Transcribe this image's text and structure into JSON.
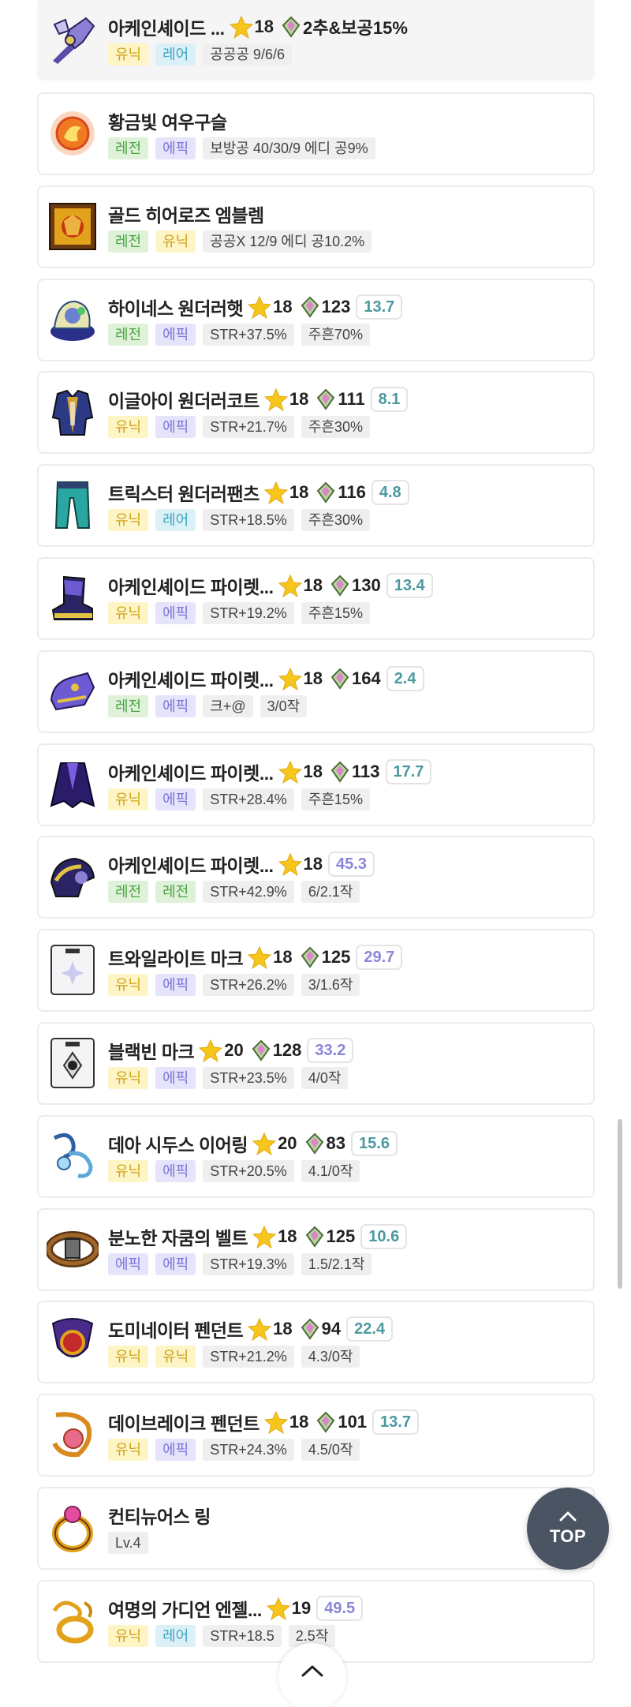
{
  "items": [
    {
      "name": "아케인셰이드 ...",
      "icon": "arcane-shade-weapon-icon",
      "star": "18",
      "gem": "",
      "extra": "2추&보공15%",
      "score": "",
      "score_color": "",
      "tags": [
        "유닉",
        "레어"
      ],
      "tag_types": [
        "unique",
        "rare"
      ],
      "opts": [
        "공공공 9/6/6"
      ]
    },
    {
      "name": "황금빛 여우구슬",
      "icon": "golden-fox-marble-icon",
      "star": "",
      "gem": "",
      "extra": "",
      "score": "",
      "score_color": "",
      "tags": [
        "레전",
        "에픽"
      ],
      "tag_types": [
        "legend",
        "epic"
      ],
      "opts": [
        "보방공 40/30/9 에디 공9%"
      ]
    },
    {
      "name": "골드 히어로즈 엠블렘",
      "icon": "gold-heroes-emblem-icon",
      "star": "",
      "gem": "",
      "extra": "",
      "score": "",
      "score_color": "",
      "tags": [
        "레전",
        "유닉"
      ],
      "tag_types": [
        "legend",
        "unique"
      ],
      "opts": [
        "공공X 12/9 에디 공10.2%"
      ]
    },
    {
      "name": "하이네스 원더러햇",
      "icon": "highness-wanderer-hat-icon",
      "star": "18",
      "gem": "123",
      "extra": "",
      "score": "13.7",
      "score_color": "teal",
      "tags": [
        "레전",
        "에픽"
      ],
      "tag_types": [
        "legend",
        "epic"
      ],
      "opts": [
        "STR+37.5%",
        "주흔70%"
      ]
    },
    {
      "name": "이글아이 원더러코트",
      "icon": "eagle-eye-wanderer-coat-icon",
      "star": "18",
      "gem": "111",
      "extra": "",
      "score": "8.1",
      "score_color": "teal",
      "tags": [
        "유닉",
        "에픽"
      ],
      "tag_types": [
        "unique",
        "epic"
      ],
      "opts": [
        "STR+21.7%",
        "주흔30%"
      ]
    },
    {
      "name": "트릭스터 원더러팬츠",
      "icon": "trickster-wanderer-pants-icon",
      "star": "18",
      "gem": "116",
      "extra": "",
      "score": "4.8",
      "score_color": "teal",
      "tags": [
        "유닉",
        "레어"
      ],
      "tag_types": [
        "unique",
        "rare"
      ],
      "opts": [
        "STR+18.5%",
        "주흔30%"
      ]
    },
    {
      "name": "아케인셰이드 파이렛...",
      "icon": "arcane-shade-pirate-shoes-icon",
      "star": "18",
      "gem": "130",
      "extra": "",
      "score": "13.4",
      "score_color": "teal",
      "tags": [
        "유닉",
        "에픽"
      ],
      "tag_types": [
        "unique",
        "epic"
      ],
      "opts": [
        "STR+19.2%",
        "주흔15%"
      ]
    },
    {
      "name": "아케인셰이드 파이렛...",
      "icon": "arcane-shade-pirate-gloves-icon",
      "star": "18",
      "gem": "164",
      "extra": "",
      "score": "2.4",
      "score_color": "teal",
      "tags": [
        "레전",
        "에픽"
      ],
      "tag_types": [
        "legend",
        "epic"
      ],
      "opts": [
        "크+@",
        "3/0작"
      ]
    },
    {
      "name": "아케인셰이드 파이렛...",
      "icon": "arcane-shade-pirate-cape-icon",
      "star": "18",
      "gem": "113",
      "extra": "",
      "score": "17.7",
      "score_color": "teal",
      "tags": [
        "유닉",
        "에픽"
      ],
      "tag_types": [
        "unique",
        "epic"
      ],
      "opts": [
        "STR+28.4%",
        "주흔15%"
      ]
    },
    {
      "name": "아케인셰이드 파이렛...",
      "icon": "arcane-shade-pirate-shoulder-icon",
      "star": "18",
      "gem": "",
      "extra": "",
      "score": "45.3",
      "score_color": "purple",
      "tags": [
        "레전",
        "레전"
      ],
      "tag_types": [
        "legend",
        "legend"
      ],
      "opts": [
        "STR+42.9%",
        "6/2.1작"
      ]
    },
    {
      "name": "트와일라이트 마크",
      "icon": "twilight-mark-icon",
      "star": "18",
      "gem": "125",
      "extra": "",
      "score": "29.7",
      "score_color": "purple",
      "tags": [
        "유닉",
        "에픽"
      ],
      "tag_types": [
        "unique",
        "epic"
      ],
      "opts": [
        "STR+26.2%",
        "3/1.6작"
      ]
    },
    {
      "name": "블랙빈 마크",
      "icon": "blackbean-mark-icon",
      "star": "20",
      "gem": "128",
      "extra": "",
      "score": "33.2",
      "score_color": "purple",
      "tags": [
        "유닉",
        "에픽"
      ],
      "tag_types": [
        "unique",
        "epic"
      ],
      "opts": [
        "STR+23.5%",
        "4/0작"
      ]
    },
    {
      "name": "데아 시두스 이어링",
      "icon": "dea-sidus-earring-icon",
      "star": "20",
      "gem": "83",
      "extra": "",
      "score": "15.6",
      "score_color": "teal",
      "tags": [
        "유닉",
        "에픽"
      ],
      "tag_types": [
        "unique",
        "epic"
      ],
      "opts": [
        "STR+20.5%",
        "4.1/0작"
      ]
    },
    {
      "name": "분노한 자쿰의 벨트",
      "icon": "angry-zakum-belt-icon",
      "star": "18",
      "gem": "125",
      "extra": "",
      "score": "10.6",
      "score_color": "teal",
      "tags": [
        "에픽",
        "에픽"
      ],
      "tag_types": [
        "epic",
        "epic"
      ],
      "opts": [
        "STR+19.3%",
        "1.5/2.1작"
      ]
    },
    {
      "name": "도미네이터 펜던트",
      "icon": "dominator-pendant-icon",
      "star": "18",
      "gem": "94",
      "extra": "",
      "score": "22.4",
      "score_color": "teal",
      "tags": [
        "유닉",
        "유닉"
      ],
      "tag_types": [
        "unique",
        "unique"
      ],
      "opts": [
        "STR+21.2%",
        "4.3/0작"
      ]
    },
    {
      "name": "데이브레이크 펜던트",
      "icon": "daybreak-pendant-icon",
      "star": "18",
      "gem": "101",
      "extra": "",
      "score": "13.7",
      "score_color": "teal",
      "tags": [
        "유닉",
        "에픽"
      ],
      "tag_types": [
        "unique",
        "epic"
      ],
      "opts": [
        "STR+24.3%",
        "4.5/0작"
      ]
    },
    {
      "name": "컨티뉴어스 링",
      "icon": "continuous-ring-icon",
      "star": "",
      "gem": "",
      "extra": "",
      "score": "",
      "score_color": "",
      "tags": [],
      "tag_types": [],
      "opts": [
        "Lv.4"
      ]
    },
    {
      "name": "여명의 가디언 엔젤...",
      "icon": "dawn-guardian-angel-ring-icon",
      "star": "19",
      "gem": "",
      "extra": "",
      "score": "49.5",
      "score_color": "purple",
      "tags": [
        "유닉",
        "레어"
      ],
      "tag_types": [
        "unique",
        "rare"
      ],
      "opts": [
        "STR+18.5",
        "2.5작"
      ]
    }
  ],
  "top_button": {
    "label": "TOP",
    "icon": "chevron-up-icon"
  },
  "scroll_down_button": {
    "icon": "chevron-up-icon"
  },
  "colors": {
    "star": "#f6c61d",
    "teal_score": "#4c9aa0",
    "purple_score": "#8a86d9",
    "top_button_bg": "#4a5463"
  }
}
